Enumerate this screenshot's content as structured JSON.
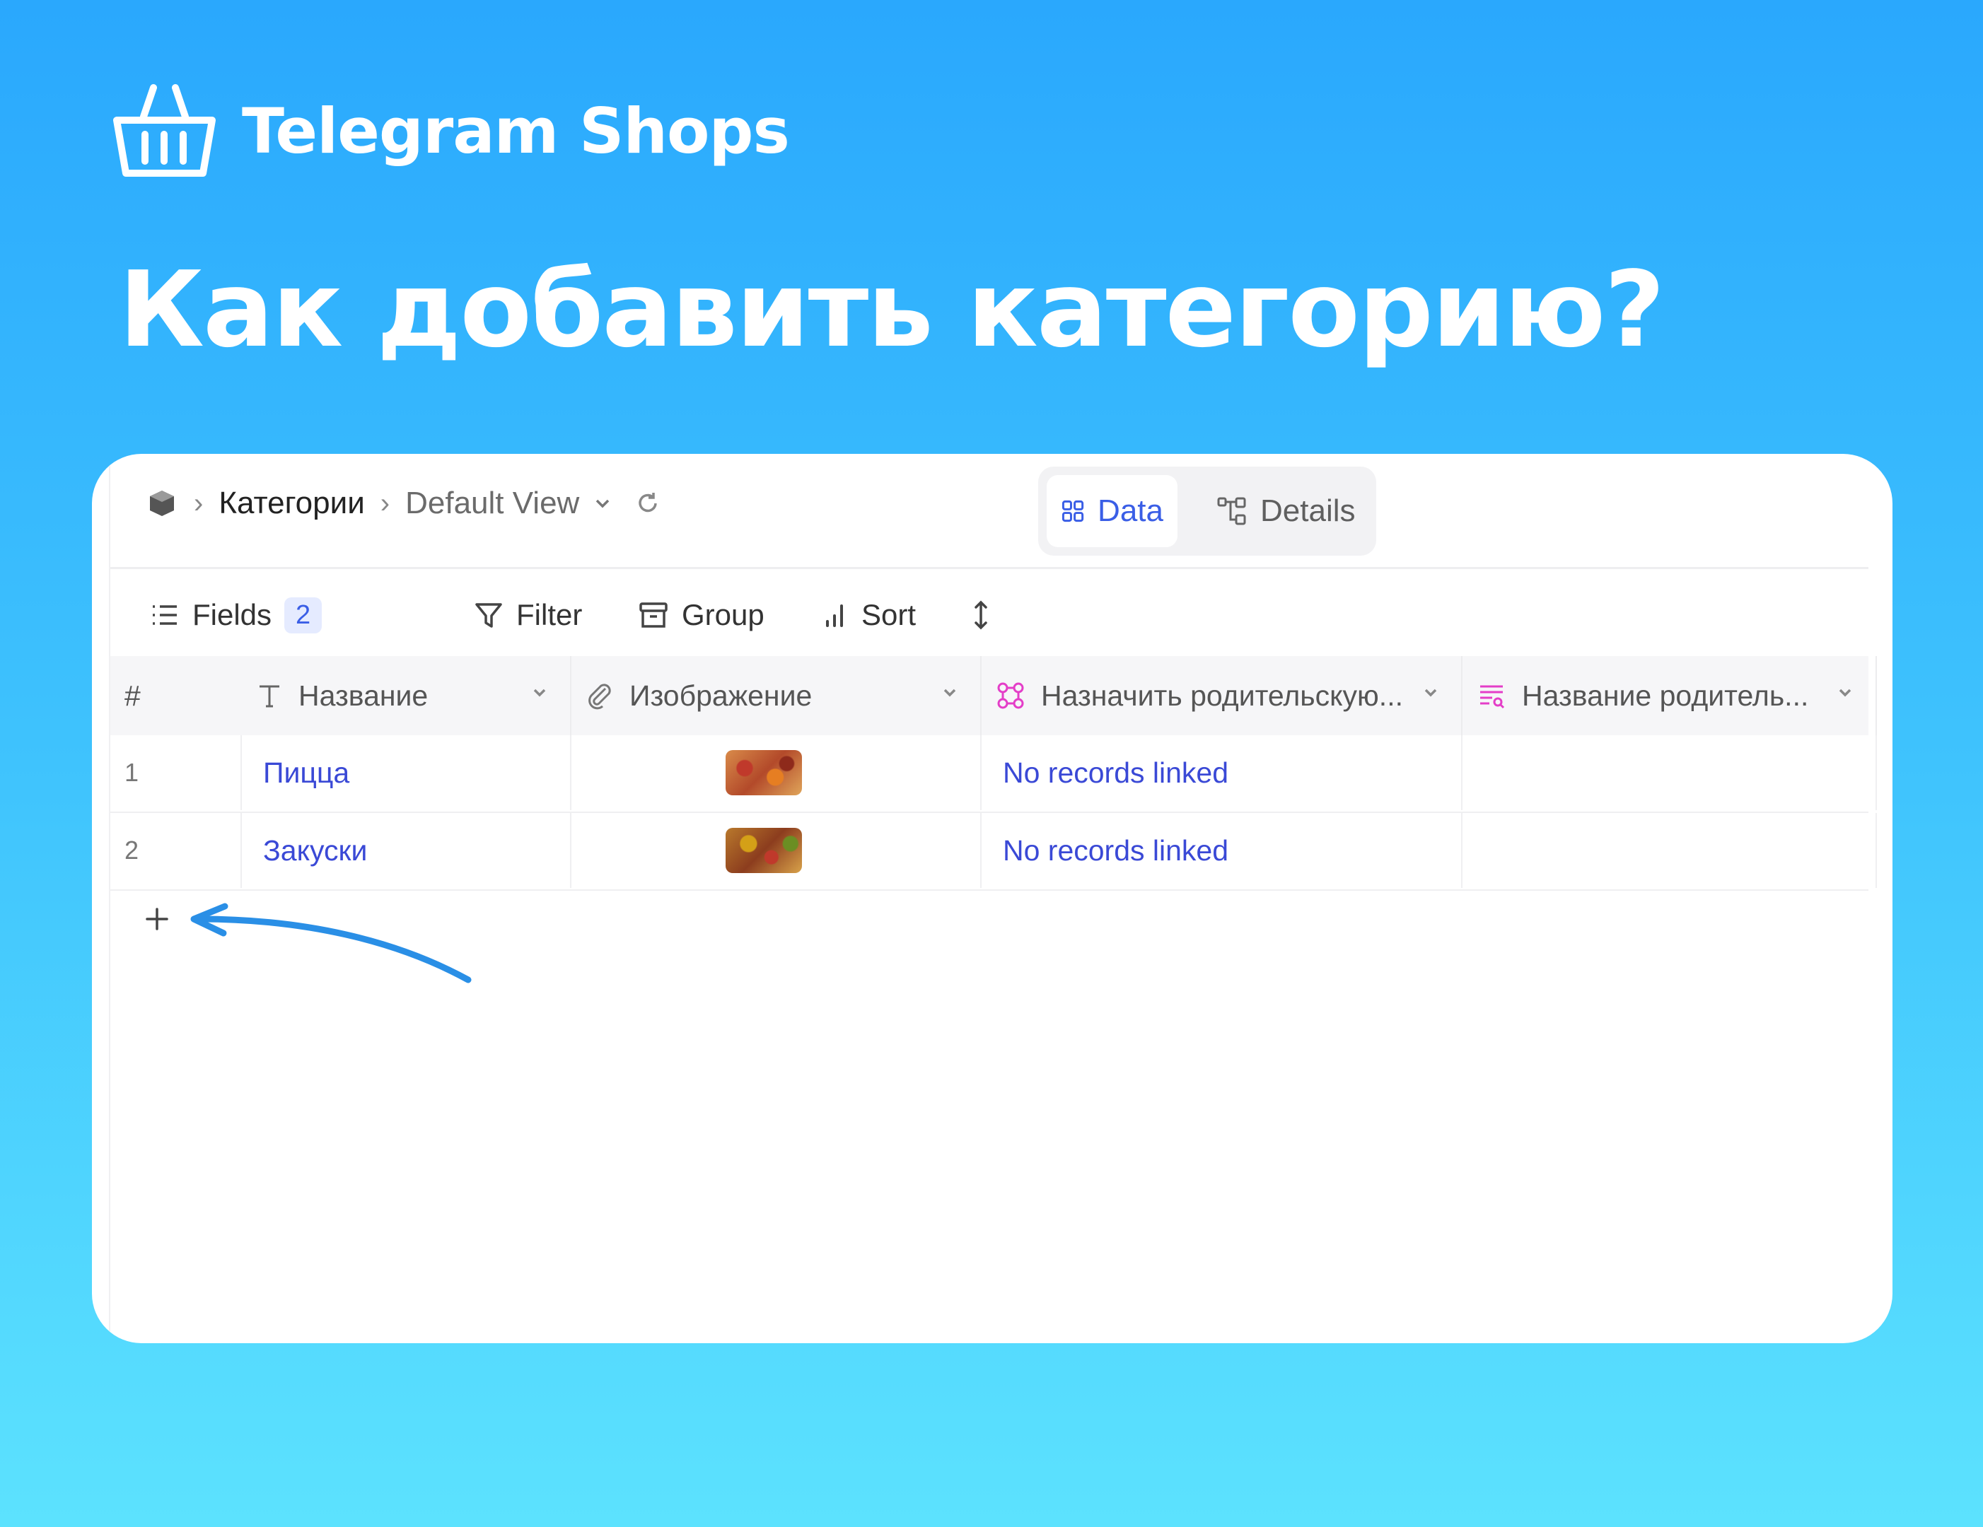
{
  "brand": {
    "name": "Telegram Shops",
    "icon": "basket-icon"
  },
  "headline": "Как добавить категорию?",
  "breadcrumb": {
    "icon": "database-icon",
    "table": "Категории",
    "view": "Default View",
    "view_icon": "chevron-down-icon",
    "refresh_icon": "refresh-icon"
  },
  "tabs": [
    {
      "label": "Data",
      "icon": "grid-icon",
      "active": true
    },
    {
      "label": "Details",
      "icon": "schema-icon",
      "active": false
    }
  ],
  "toolbar": {
    "fields_label": "Fields",
    "fields_count": "2",
    "filter_label": "Filter",
    "group_label": "Group",
    "sort_label": "Sort",
    "row_height_icon": "row-height-icon"
  },
  "columns": [
    {
      "label": "#",
      "icon": ""
    },
    {
      "label": "Название",
      "icon": "text-type-icon"
    },
    {
      "label": "Изображение",
      "icon": "paperclip-icon"
    },
    {
      "label": "Назначить родительскую...",
      "icon": "link-records-icon"
    },
    {
      "label": "Название родитель...",
      "icon": "lookup-icon"
    }
  ],
  "rows": [
    {
      "index": "1",
      "name": "Пицца",
      "image": "pizza-thumbnail",
      "link": "No records linked",
      "parent_name": ""
    },
    {
      "index": "2",
      "name": "Закуски",
      "image": "snacks-thumbnail",
      "link": "No records linked",
      "parent_name": ""
    }
  ],
  "add_row_icon": "plus-icon",
  "annotation": "arrow-pointer",
  "colors": {
    "accent": "#3a5ee6",
    "link": "#3a49d6",
    "pink": "#e43ec8",
    "arrow": "#2a8fe6"
  }
}
